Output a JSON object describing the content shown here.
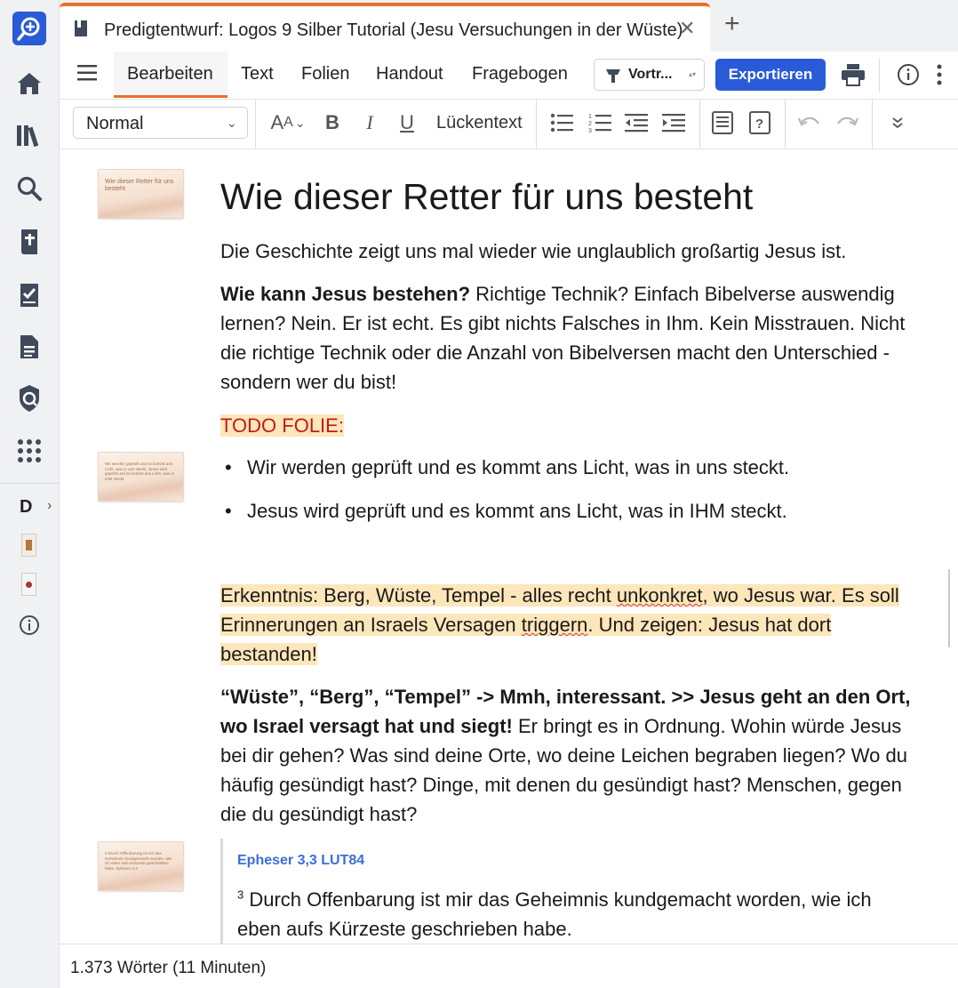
{
  "tab": {
    "title": "Predigtentwurf: Logos 9 Silber Tutorial (Jesu Versuchungen in der Wüste)",
    "close": "✕",
    "add": "+"
  },
  "menu": {
    "tabs": [
      "Bearbeiten",
      "Text",
      "Folien",
      "Handout",
      "Fragebogen"
    ],
    "active_tab": "Bearbeiten",
    "mode_label": "Vortr...",
    "export_label": "Exportieren"
  },
  "format": {
    "style_value": "Normal",
    "cloze_label": "Lückentext"
  },
  "rail": {
    "collection_letter": "D"
  },
  "document": {
    "heading": "Wie dieser Retter für uns besteht",
    "p1": "Die Geschichte zeigt uns mal wieder wie unglaublich großartig Jesus ist.",
    "p2_bold": "Wie kann Jesus bestehen?",
    "p2_rest": " Richtige Technik? Einfach Bibelverse auswendig lernen? Nein. Er ist echt. Es gibt nichts Falsches in Ihm. Kein Misstrauen. Nicht die richtige Technik oder die Anzahl von Bibelversen macht den Unterschied - sondern wer du bist!",
    "todo": "TODO FOLIE:",
    "bullets": [
      "Wir werden geprüft und es kommt ans Licht, was in uns steckt.",
      "Jesus wird geprüft und es kommt ans Licht, was in IHM steckt."
    ],
    "insight_a": "Erkenntnis: Berg, Wüste, Tempel - alles recht ",
    "insight_sq1": "unkonkret",
    "insight_b": ", wo Jesus war. Es soll Erinnerungen an Israels Versagen ",
    "insight_sq2": "triggern",
    "insight_c": ". Und zeigen: Jesus hat dort bestanden!",
    "p4_bold": "“Wüste”, “Berg”, “Tempel” -> Mmh, interessant. >> Jesus geht an den Ort, wo Israel versagt hat und siegt!",
    "p4_rest": " Er bringt es in Ordnung. Wohin würde Jesus bei dir gehen? Was sind deine Orte, wo deine Leichen begraben liegen? Wo du häufig gesündigt hast? Dinge, mit denen du gesündigt hast? Menschen, gegen die du gesündigt hast?",
    "quote_ref": "Epheser 3,3 LUT84",
    "quote_verse": "3",
    "quote_text": " Durch Offenbarung ist mir das Geheimnis kundgemacht worden, wie ich eben aufs Kürzeste geschrieben habe."
  },
  "slides": [
    "Wie dieser Retter für uns besteht",
    "Wir werden geprüft und es kommt ans Licht, was in uns steckt. Jesus wird geprüft und es kommt ans Licht, was in IHM steckt.",
    "3 Durch Offenbarung ist mir das Geheimnis kundgemacht worden, wie ich eben aufs Kürzeste geschrieben habe. Epheser 3,3"
  ],
  "status": {
    "word_count": "1.373 Wörter (11 Minuten)"
  },
  "colors": {
    "accent": "#e8702a",
    "primary": "#2a5bd7",
    "highlight": "#fde6ba",
    "todo_text": "#c01b1b",
    "reference": "#3a6fd8"
  }
}
